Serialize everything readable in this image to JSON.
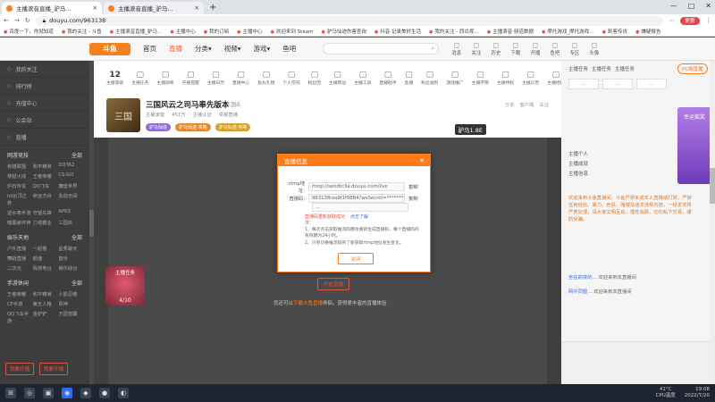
{
  "browser": {
    "tabs": [
      {
        "title": "主播滚音直播_驴马…",
        "active": true
      },
      {
        "title": "主播滚音直播_驴马…",
        "active": false
      }
    ],
    "new_tab": "+",
    "window_title": "…",
    "window_controls": [
      "—",
      "□",
      "✕"
    ],
    "url": "douyu.com/963138",
    "profile_label": "更新",
    "bookmarks": [
      "百度一下，你就知道",
      "我的关注 - 斗鱼",
      "主播滚音直播_驴马…",
      "主播中心",
      "我的订阅",
      "主播中心",
      "欢迎来到 Steam",
      "驴马仙迹伤害查询",
      "抖音·记录美好生活",
      "我的关注 - 西瓜视…",
      "主播滚音·频道数据",
      "摩托游戏_摩托游戏…",
      "刺客传说",
      "嫌疑报告"
    ]
  },
  "site_nav": {
    "logo": "斗鱼",
    "links": [
      "首页",
      "直播",
      "分类▾",
      "视频▾",
      "游戏▾",
      "鱼吧"
    ],
    "active_index": 1,
    "icons": [
      "消息",
      "关注",
      "历史",
      "下载",
      "开播",
      "鱼吧",
      "专区",
      "头像"
    ]
  },
  "sidebar": {
    "items": [
      "我的关注",
      "排行榜",
      "充值中心",
      "公会站",
      "直播"
    ],
    "section1": {
      "title": "网游竞技",
      "more": "全部",
      "entries": [
        "英雄联盟",
        "和平精英",
        "DOTA2",
        "穿越火线",
        "王者荣耀",
        "CS:GO",
        "炉石传说",
        "QQ飞车",
        "魔兽世界",
        "lol云顶之弈",
        "命运方舟",
        "永劫无间",
        "逆水寒手游",
        "守望先锋",
        "APEX",
        "暗黑破坏神",
        "刀塔霸业",
        "三国杀"
      ]
    },
    "section2": {
      "title": "娱乐天地",
      "more": "全部",
      "entries": [
        "户外直播",
        "一起看",
        "星秀聊天",
        "舞蹈直播",
        "颜值",
        "音乐",
        "二次元",
        "情感电台",
        "娱乐综合"
      ]
    },
    "section3": {
      "title": "手游休闲",
      "more": "全部",
      "entries": [
        "王者荣耀",
        "和平精英",
        "火影忍者",
        "CF手游",
        "第五人格",
        "原神",
        "QQ飞车手游",
        "金铲铲",
        "万国觉醒"
      ]
    },
    "buttons": [
      "我要开播",
      "我要开播"
    ]
  },
  "categories": {
    "count": "12",
    "count_label": "主播等级",
    "items": [
      "主播任务",
      "主播勋章",
      "开播提醒",
      "主播日历",
      "直播中心",
      "鱼丸礼物",
      "个人空间",
      "粉丝团",
      "主播周边",
      "主播工具",
      "直播助手",
      "鱼塘",
      "粉丝福利",
      "游戏推广",
      "主播学院",
      "主播特权",
      "主播公告",
      "主播经纪",
      "开播设置",
      "主播收益"
    ]
  },
  "room": {
    "avatar_text": "三国",
    "title": "三国风云之司马奉先版本",
    "tag": "三国杀",
    "meta": [
      "主播滚音",
      "451万",
      "主播认证",
      "举报直播"
    ],
    "tags": [
      "驴马仙迹",
      "驴马仙迹·攻略",
      "驴马仙迹·攻略"
    ],
    "heat": "驴马1.8E",
    "actions": [
      "分享",
      "客户端",
      "关注"
    ]
  },
  "player": {
    "badge_title": "主播任务",
    "badge_count": "4/10",
    "open_button": "开始直播",
    "hint_prefix": "您还可以",
    "hint_link": "下载斗鱼直播",
    "hint_suffix": "伴侣，获得更丰富的直播体验"
  },
  "modal": {
    "title": "直播信息",
    "close": "✕",
    "rtmp_label": "rtmp地址:",
    "rtmp_value": "rtmp://sendtc3a.douyu.com/live",
    "code_label": "直播码:",
    "code_value": "963138rza9f1f98B4?wsSecret=***********",
    "code_value2": "…",
    "copy": "复制",
    "warning": "直播码重新获取成功",
    "link": "点击了解",
    "tips_title": "注：",
    "tips": [
      "1、每次点击获取推流码都会重新生成直播码，每个直播码的有效期为24小时。",
      "2、只有切换推流码到了新获取rtmp地址发生变化。"
    ],
    "close_button": "关闭"
  },
  "right_panel": {
    "header": [
      "主播任务",
      "主播任务",
      "主播任务"
    ],
    "pc_button": "PC端直播",
    "mini_buttons": [
      "…",
      "…",
      "…",
      "…"
    ],
    "promo": "幸运摇奖",
    "list": [
      "主播个人",
      "主播成就",
      "主播信息"
    ],
    "chat_notice": "欢迎来到斗鱼直播间，斗鱼严禁未成年人直播或打赏，严禁任何低俗、暴力、色情、赌博及违法违规内容，一经发现将严肃处理，请大家文明互动，理性消费，切勿私下交易，谨防受骗。",
    "messages": [
      {
        "name": "坐在前排的…",
        "text": "欢迎来到本直播间"
      },
      {
        "name": "网中同盟…",
        "text": "欢迎来到本直播间"
      }
    ]
  },
  "taskbar": {
    "apps": [
      "⊞",
      "◎",
      "▣",
      "◉",
      "◆",
      "●",
      "◐"
    ],
    "temp": "41°C",
    "temp_label": "CPU温度",
    "time": "19:08",
    "date": "2022/7/20"
  }
}
